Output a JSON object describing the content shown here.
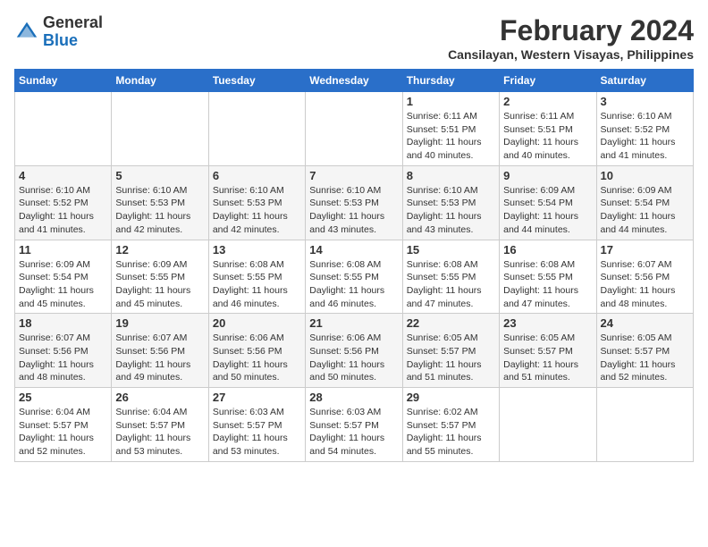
{
  "header": {
    "logo_general": "General",
    "logo_blue": "Blue",
    "month_year": "February 2024",
    "location": "Cansilayan, Western Visayas, Philippines"
  },
  "days_of_week": [
    "Sunday",
    "Monday",
    "Tuesday",
    "Wednesday",
    "Thursday",
    "Friday",
    "Saturday"
  ],
  "weeks": [
    [
      {
        "day": "",
        "info": ""
      },
      {
        "day": "",
        "info": ""
      },
      {
        "day": "",
        "info": ""
      },
      {
        "day": "",
        "info": ""
      },
      {
        "day": "1",
        "info": "Sunrise: 6:11 AM\nSunset: 5:51 PM\nDaylight: 11 hours\nand 40 minutes."
      },
      {
        "day": "2",
        "info": "Sunrise: 6:11 AM\nSunset: 5:51 PM\nDaylight: 11 hours\nand 40 minutes."
      },
      {
        "day": "3",
        "info": "Sunrise: 6:10 AM\nSunset: 5:52 PM\nDaylight: 11 hours\nand 41 minutes."
      }
    ],
    [
      {
        "day": "4",
        "info": "Sunrise: 6:10 AM\nSunset: 5:52 PM\nDaylight: 11 hours\nand 41 minutes."
      },
      {
        "day": "5",
        "info": "Sunrise: 6:10 AM\nSunset: 5:53 PM\nDaylight: 11 hours\nand 42 minutes."
      },
      {
        "day": "6",
        "info": "Sunrise: 6:10 AM\nSunset: 5:53 PM\nDaylight: 11 hours\nand 42 minutes."
      },
      {
        "day": "7",
        "info": "Sunrise: 6:10 AM\nSunset: 5:53 PM\nDaylight: 11 hours\nand 43 minutes."
      },
      {
        "day": "8",
        "info": "Sunrise: 6:10 AM\nSunset: 5:53 PM\nDaylight: 11 hours\nand 43 minutes."
      },
      {
        "day": "9",
        "info": "Sunrise: 6:09 AM\nSunset: 5:54 PM\nDaylight: 11 hours\nand 44 minutes."
      },
      {
        "day": "10",
        "info": "Sunrise: 6:09 AM\nSunset: 5:54 PM\nDaylight: 11 hours\nand 44 minutes."
      }
    ],
    [
      {
        "day": "11",
        "info": "Sunrise: 6:09 AM\nSunset: 5:54 PM\nDaylight: 11 hours\nand 45 minutes."
      },
      {
        "day": "12",
        "info": "Sunrise: 6:09 AM\nSunset: 5:55 PM\nDaylight: 11 hours\nand 45 minutes."
      },
      {
        "day": "13",
        "info": "Sunrise: 6:08 AM\nSunset: 5:55 PM\nDaylight: 11 hours\nand 46 minutes."
      },
      {
        "day": "14",
        "info": "Sunrise: 6:08 AM\nSunset: 5:55 PM\nDaylight: 11 hours\nand 46 minutes."
      },
      {
        "day": "15",
        "info": "Sunrise: 6:08 AM\nSunset: 5:55 PM\nDaylight: 11 hours\nand 47 minutes."
      },
      {
        "day": "16",
        "info": "Sunrise: 6:08 AM\nSunset: 5:55 PM\nDaylight: 11 hours\nand 47 minutes."
      },
      {
        "day": "17",
        "info": "Sunrise: 6:07 AM\nSunset: 5:56 PM\nDaylight: 11 hours\nand 48 minutes."
      }
    ],
    [
      {
        "day": "18",
        "info": "Sunrise: 6:07 AM\nSunset: 5:56 PM\nDaylight: 11 hours\nand 48 minutes."
      },
      {
        "day": "19",
        "info": "Sunrise: 6:07 AM\nSunset: 5:56 PM\nDaylight: 11 hours\nand 49 minutes."
      },
      {
        "day": "20",
        "info": "Sunrise: 6:06 AM\nSunset: 5:56 PM\nDaylight: 11 hours\nand 50 minutes."
      },
      {
        "day": "21",
        "info": "Sunrise: 6:06 AM\nSunset: 5:56 PM\nDaylight: 11 hours\nand 50 minutes."
      },
      {
        "day": "22",
        "info": "Sunrise: 6:05 AM\nSunset: 5:57 PM\nDaylight: 11 hours\nand 51 minutes."
      },
      {
        "day": "23",
        "info": "Sunrise: 6:05 AM\nSunset: 5:57 PM\nDaylight: 11 hours\nand 51 minutes."
      },
      {
        "day": "24",
        "info": "Sunrise: 6:05 AM\nSunset: 5:57 PM\nDaylight: 11 hours\nand 52 minutes."
      }
    ],
    [
      {
        "day": "25",
        "info": "Sunrise: 6:04 AM\nSunset: 5:57 PM\nDaylight: 11 hours\nand 52 minutes."
      },
      {
        "day": "26",
        "info": "Sunrise: 6:04 AM\nSunset: 5:57 PM\nDaylight: 11 hours\nand 53 minutes."
      },
      {
        "day": "27",
        "info": "Sunrise: 6:03 AM\nSunset: 5:57 PM\nDaylight: 11 hours\nand 53 minutes."
      },
      {
        "day": "28",
        "info": "Sunrise: 6:03 AM\nSunset: 5:57 PM\nDaylight: 11 hours\nand 54 minutes."
      },
      {
        "day": "29",
        "info": "Sunrise: 6:02 AM\nSunset: 5:57 PM\nDaylight: 11 hours\nand 55 minutes."
      },
      {
        "day": "",
        "info": ""
      },
      {
        "day": "",
        "info": ""
      }
    ]
  ]
}
